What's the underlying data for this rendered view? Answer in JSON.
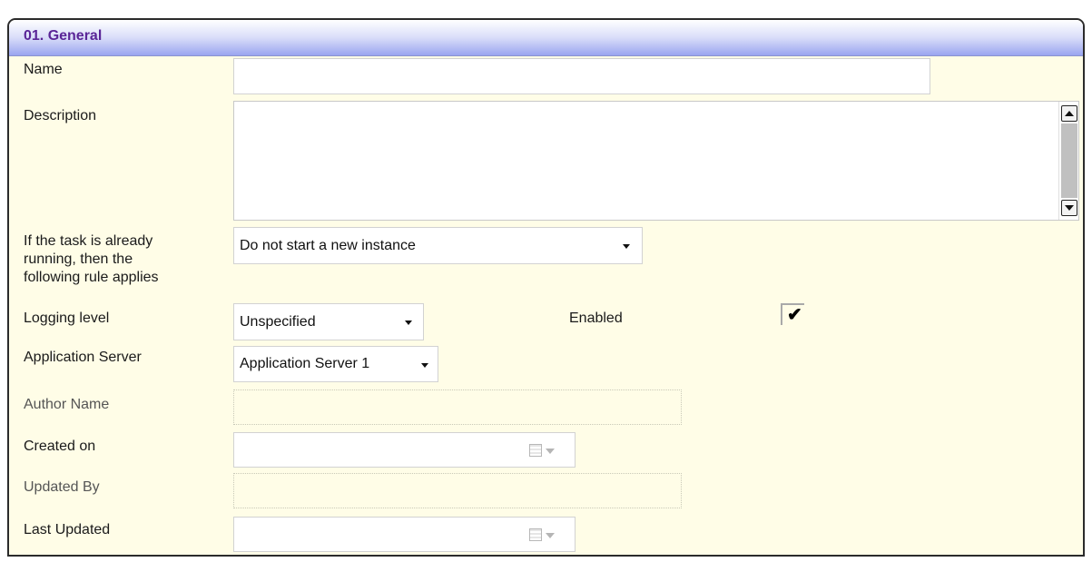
{
  "section": {
    "title": "01. General"
  },
  "fields": {
    "name_label": "Name",
    "name_value": "",
    "description_label": "Description",
    "description_value": "",
    "rule_label_line1": "If the task is already",
    "rule_label_line2": "running, then the",
    "rule_label_line3": "following rule applies",
    "rule_value": "Do not start a new instance",
    "logging_label": "Logging level",
    "logging_value": "Unspecified",
    "enabled_label": "Enabled",
    "enabled_checked": "✔",
    "app_server_label": "Application Server",
    "app_server_value": "Application Server 1",
    "author_label": "Author Name",
    "author_value": "",
    "created_label": "Created on",
    "created_value": "",
    "updated_by_label": "Updated By",
    "updated_by_value": "",
    "last_updated_label": "Last Updated",
    "last_updated_value": ""
  },
  "colors": {
    "panel_bg": "#fffde7",
    "title_color": "#5a2597",
    "header_gradient_end": "#9aa5f0"
  },
  "icons": {
    "scroll_up": "triangle-up-icon",
    "scroll_down": "triangle-down-icon",
    "dropdown": "chevron-down-icon",
    "calendar": "calendar-icon",
    "check": "checkmark-icon"
  }
}
